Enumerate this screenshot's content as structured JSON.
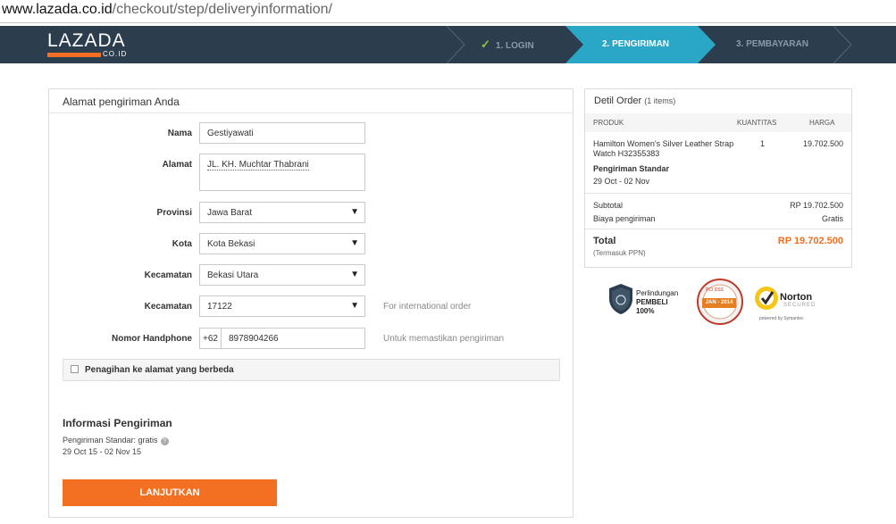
{
  "browser": {
    "url_host": "www.lazada.co.id",
    "url_path": "/checkout/step/deliveryinformation/"
  },
  "header": {
    "logo_text": "LAZADA",
    "logo_sub": "CO.ID",
    "steps": [
      {
        "label": "1. LOGIN",
        "state": "done"
      },
      {
        "label": "2. PENGIRIMAN",
        "state": "active"
      },
      {
        "label": "3. PEMBAYARAN",
        "state": "upcoming"
      }
    ],
    "colors": {
      "bar": "#2c3d4d",
      "active": "#2aa6c6",
      "accent": "#f36f21"
    }
  },
  "address": {
    "title": "Alamat pengiriman Anda",
    "fields": {
      "nama": {
        "label": "Nama",
        "value": "Gestiyawati"
      },
      "alamat": {
        "label": "Alamat",
        "value": "JL. KH. Muchtar Thabrani"
      },
      "provinsi": {
        "label": "Provinsi",
        "value": "Jawa Barat"
      },
      "kota": {
        "label": "Kota",
        "value": "Kota Bekasi"
      },
      "kecamatan": {
        "label": "Kecamatan",
        "value": "Bekasi Utara"
      },
      "kodepos": {
        "label": "Kecamatan",
        "value": "17122",
        "hint": "For international order"
      },
      "phone": {
        "label": "Nomor Handphone",
        "prefix": "+62",
        "value": "8978904266",
        "hint": "Untuk memastikan pengiriman"
      }
    },
    "billing_checkbox": {
      "label": "Penagihan ke alamat yang berbeda",
      "checked": false
    }
  },
  "shipping_info": {
    "title": "Informasi Pengiriman",
    "line1": "Pengiriman Standar: gratis",
    "line2": "29 Oct 15 - 02 Nov 15"
  },
  "actions": {
    "next_label": "LANJUTKAN"
  },
  "order": {
    "title": "Detil Order",
    "count": "(1 items)",
    "headers": {
      "product": "PRODUK",
      "qty": "KUANTITAS",
      "price": "HARGA"
    },
    "item": {
      "name": "Hamilton Women's Silver Leather Strap Watch H32355383",
      "qty": "1",
      "price": "19.702.500",
      "shipping_title": "Pengiriman Standar",
      "shipping_date": "29 Oct - 02 Nov"
    },
    "subtotal_label": "Subtotal",
    "subtotal_value": "RP 19.702.500",
    "shipping_label": "Biaya pengiriman",
    "shipping_value": "Gratis",
    "total_label": "Total",
    "total_note": "(Termasuk PPN)",
    "total_value": "RP 19.702.500"
  },
  "badges": {
    "protection_line1": "Perlindungan",
    "protection_line2": "PEMBELI",
    "protection_line3": "100%",
    "pci_top": "PCI DSS",
    "pci_date": "JAN - 2014",
    "norton_word": "Norton",
    "norton_secured": "SECURED",
    "norton_by": "powered by Symantec"
  }
}
